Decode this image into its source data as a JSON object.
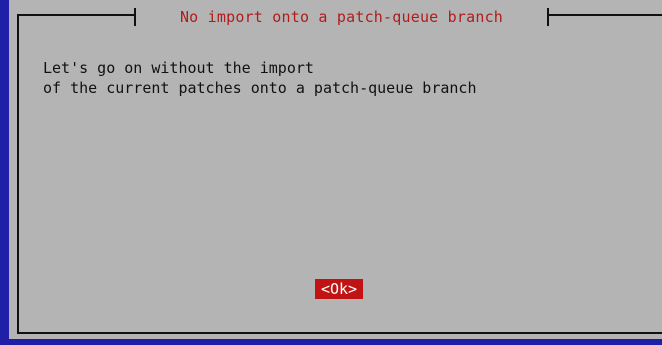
{
  "dialog": {
    "title": "No import onto a patch-queue branch",
    "message_lines": [
      "Let's go on without the import",
      "of the current patches onto a patch-queue branch"
    ],
    "ok_label": "<Ok>"
  },
  "colors": {
    "background": "#1f1fa8",
    "dialog": "#b4b4b4",
    "title": "#b01c1c",
    "button_bg": "#c01414",
    "button_text": "#ffffff"
  }
}
